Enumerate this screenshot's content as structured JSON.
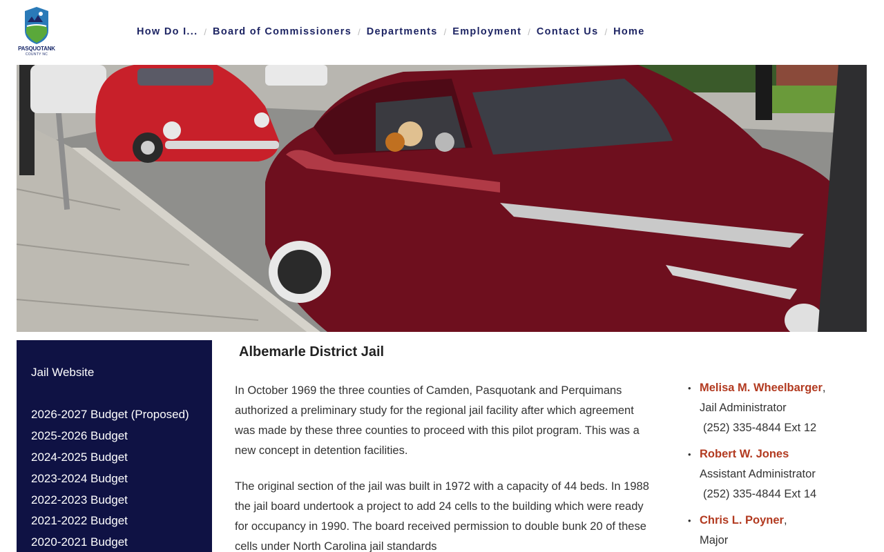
{
  "logo": {
    "name": "PASQUOTANK",
    "sub": "COUNTY NC"
  },
  "nav": {
    "items": [
      {
        "label": "How Do I..."
      },
      {
        "label": "Board of Commissioners"
      },
      {
        "label": "Departments"
      },
      {
        "label": "Employment"
      },
      {
        "label": "Contact Us"
      },
      {
        "label": "Home"
      }
    ],
    "separator": "/"
  },
  "sidebar": {
    "items": [
      {
        "label": "Jail Website"
      },
      {
        "label": "2026-2027 Budget (Proposed)"
      },
      {
        "label": "2025-2026 Budget"
      },
      {
        "label": "2024-2025 Budget"
      },
      {
        "label": "2023-2024 Budget"
      },
      {
        "label": "2022-2023 Budget"
      },
      {
        "label": "2021-2022 Budget"
      },
      {
        "label": "2020-2021 Budget"
      }
    ]
  },
  "main": {
    "title": "Albemarle District Jail",
    "paragraphs": [
      "In October 1969 the three counties of Camden, Pasquotank and Perquimans authorized a preliminary study for the regional jail facility after which agreement was made by these three counties to proceed with this pilot program. This was a new concept in detention facilities.",
      "The original section of the jail was built in 1972 with a capacity of 44 beds. In 1988 the jail board undertook a project to add 24 cells to the building which were ready for occupancy in 1990. The board received permission to double bunk 20 of these cells under North Carolina jail standards"
    ]
  },
  "contacts": [
    {
      "name": "Melisa M. Wheelbarger",
      "suffix": ",",
      "title": "Jail Administrator",
      "phone": "(252) 335-4844 Ext 12"
    },
    {
      "name": "Robert W. Jones",
      "suffix": "",
      "title": "Assistant Administrator",
      "phone": "(252) 335-4844 Ext 14"
    },
    {
      "name": "Chris L. Poyner",
      "suffix": ",",
      "title": "Major",
      "phone": ""
    }
  ],
  "colors": {
    "nav_text": "#1d2463",
    "sidebar_bg": "#0f1244",
    "contact_name": "#b23a20"
  },
  "icons": {
    "bullet": "•"
  }
}
